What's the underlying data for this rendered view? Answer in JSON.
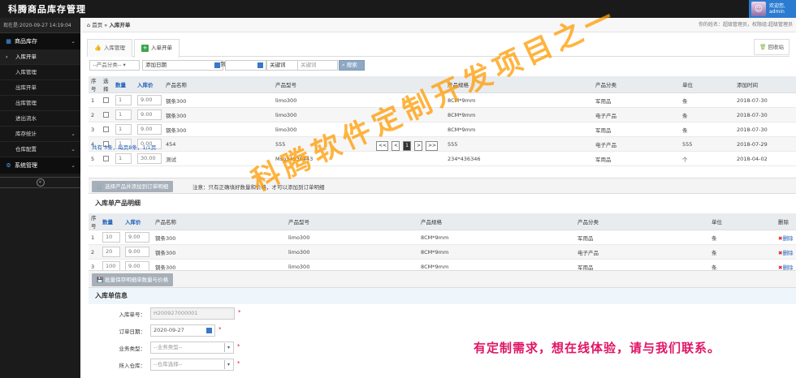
{
  "app": {
    "title": "科腾商品库存管理"
  },
  "user": {
    "greeting": "欢迎您,",
    "name": "admin"
  },
  "sidebar": {
    "time": "现在是:2020-09-27 14:19:04",
    "group1": "商品库存",
    "items": [
      "入库开单",
      "入库管理",
      "出库开单",
      "出库管理",
      "进出流水",
      "库存统计",
      "仓库配置"
    ],
    "group2": "系统管理"
  },
  "breadcrumb": {
    "home": "首页",
    "current": "入库开单",
    "right": "你的姓名：超级管理员，权限组:超级管理员"
  },
  "tabs": {
    "t1": "入库管理",
    "t2": "入单开单",
    "recycle": "回收站"
  },
  "filter": {
    "category": "--产品分类--",
    "date_label": "添加日期",
    "to": "到",
    "keyword_label": "关键词",
    "keyword_placeholder": "关键词",
    "search": "搜索"
  },
  "products": {
    "headers": [
      "序号",
      "选择",
      "数量",
      "入库价",
      "产品名称",
      "产品型号",
      "产品规格",
      "产品分类",
      "单位",
      "添加时间"
    ],
    "rows": [
      {
        "no": "1",
        "qty": "1",
        "price": "9.00",
        "name": "钢条300",
        "model": "limo300",
        "spec": "8CM*9mm",
        "cat": "军用品",
        "unit": "条",
        "date": "2018-07-30"
      },
      {
        "no": "2",
        "qty": "1",
        "price": "9.00",
        "name": "钢条300",
        "model": "limo300",
        "spec": "8CM*9mm",
        "cat": "电子产品",
        "unit": "条",
        "date": "2018-07-30"
      },
      {
        "no": "3",
        "qty": "1",
        "price": "9.00",
        "name": "钢条300",
        "model": "limo300",
        "spec": "8CM*9mm",
        "cat": "军用品",
        "unit": "条",
        "date": "2018-07-30"
      },
      {
        "no": "4",
        "qty": "1",
        "price": "0.00",
        "name": "454",
        "model": "555",
        "spec": "555",
        "cat": "电子产品",
        "unit": "555",
        "date": "2018-07-29"
      },
      {
        "no": "5",
        "qty": "1",
        "price": "30.00",
        "name": "测试",
        "model": "Msg34536443",
        "spec": "234*436346",
        "cat": "军用品",
        "unit": "个",
        "date": "2018-04-02"
      }
    ],
    "summary": "共有 5条，每页8条，1/1页",
    "pager": {
      "first": "<<",
      "prev": "<",
      "cur": "1",
      "next": ">",
      "last": ">>"
    }
  },
  "add_strip": {
    "button": "选择产品并添加到订单明细",
    "note": "注意：只有正确填好数量和价格，才可以添加到订单明细"
  },
  "detail": {
    "title": "入库单产品明细",
    "headers": [
      "序号",
      "数量",
      "入库价",
      "产品名称",
      "产品型号",
      "产品规格",
      "产品分类",
      "单位",
      "删除"
    ],
    "rows": [
      {
        "no": "1",
        "qty": "10",
        "price": "9.00",
        "name": "钢条300",
        "model": "limo300",
        "spec": "8CM*9mm",
        "cat": "军用品",
        "unit": "条"
      },
      {
        "no": "2",
        "qty": "20",
        "price": "9.00",
        "name": "钢条300",
        "model": "limo300",
        "spec": "8CM*9mm",
        "cat": "电子产品",
        "unit": "条"
      },
      {
        "no": "3",
        "qty": "100",
        "price": "9.00",
        "name": "钢条300",
        "model": "limo300",
        "spec": "8CM*9mm",
        "cat": "军用品",
        "unit": "条"
      }
    ],
    "delete_label": "删除",
    "save_button": "批量保存明细单数量与价格"
  },
  "order": {
    "title": "入库单信息",
    "no_label": "入库单号：",
    "no_value": "H200927000001",
    "date_label": "订单日期：",
    "date_value": "2020-09-27",
    "biz_label": "业务类型：",
    "biz_value": "--业务类型--",
    "wh_label": "所入仓库：",
    "wh_value": "--仓库选择--",
    "required": "*"
  },
  "watermark": "科腾软件定制开发项目之一",
  "promo": "有定制需求，想在线体验，请与我们联系。"
}
